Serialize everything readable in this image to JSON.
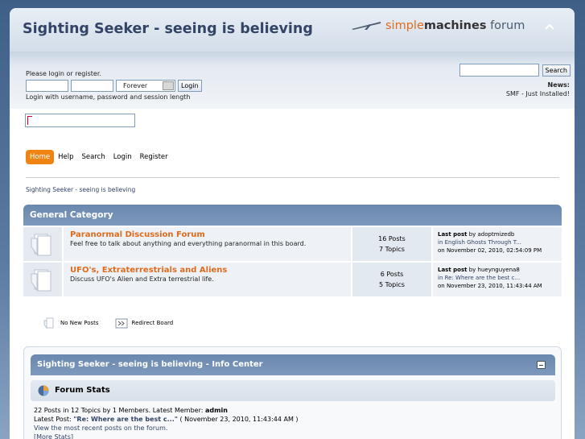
{
  "header": {
    "forum_title": "Sighting Seeker - seeing is believing",
    "logo": {
      "simple": "simple",
      "machines": "machines",
      "forum": "forum"
    }
  },
  "userbar": {
    "login_msg": "Please login or register.",
    "session_length": "Forever",
    "login_button": "Login",
    "login_hint": "Login with username, password and session length",
    "search_button": "Search",
    "news_label": "News:",
    "news_text": "SMF - Just Installed!"
  },
  "menu": {
    "items": [
      "Home",
      "Help",
      "Search",
      "Login",
      "Register"
    ]
  },
  "linktree": "Sighting Seeker - seeing is believing",
  "category": "General Category",
  "boards": [
    {
      "name": "Paranormal Discussion Forum",
      "desc": "Feel free to talk about anything and everything paranormal in this board.",
      "posts": "16 Posts",
      "topics": "7 Topics",
      "last_label": "Last post",
      "last_by": "by adoptmizedb",
      "last_in": "in English Ghosts Through T...",
      "last_on": "on November 02, 2010, 02:54:09 PM"
    },
    {
      "name": "UFO's, Extraterrestrials and Aliens",
      "desc": "Discuss UFO's Alien and Extra terrestrial life.",
      "posts": "6 Posts",
      "topics": "5 Topics",
      "last_label": "Last post",
      "last_by": "by hueynguyena8",
      "last_in": "in Re: Where are the best c...",
      "last_on": "on November 23, 2010, 11:43:44 AM"
    }
  ],
  "legend": {
    "new_posts": "No New Posts",
    "redirect": "Redirect Board"
  },
  "info_center": {
    "title": "Sighting Seeker - seeing is believing - Info Center",
    "stats_title": "Forum Stats",
    "line1_prefix": "22 Posts in 12 Topics by 1 Members. Latest Member:",
    "line1_member": "admin",
    "line2_prefix": "Latest Post:",
    "line2_post": "\"Re: Where are the best c...\"",
    "line2_suffix": "( November 23, 2010, 11:43:44 AM )",
    "line3": "View the most recent posts on the forum.",
    "line4": "[More Stats]"
  },
  "colors": {
    "accent": "#e06b1c",
    "menu_active": "#f08413",
    "catbar": "#7590b5"
  }
}
